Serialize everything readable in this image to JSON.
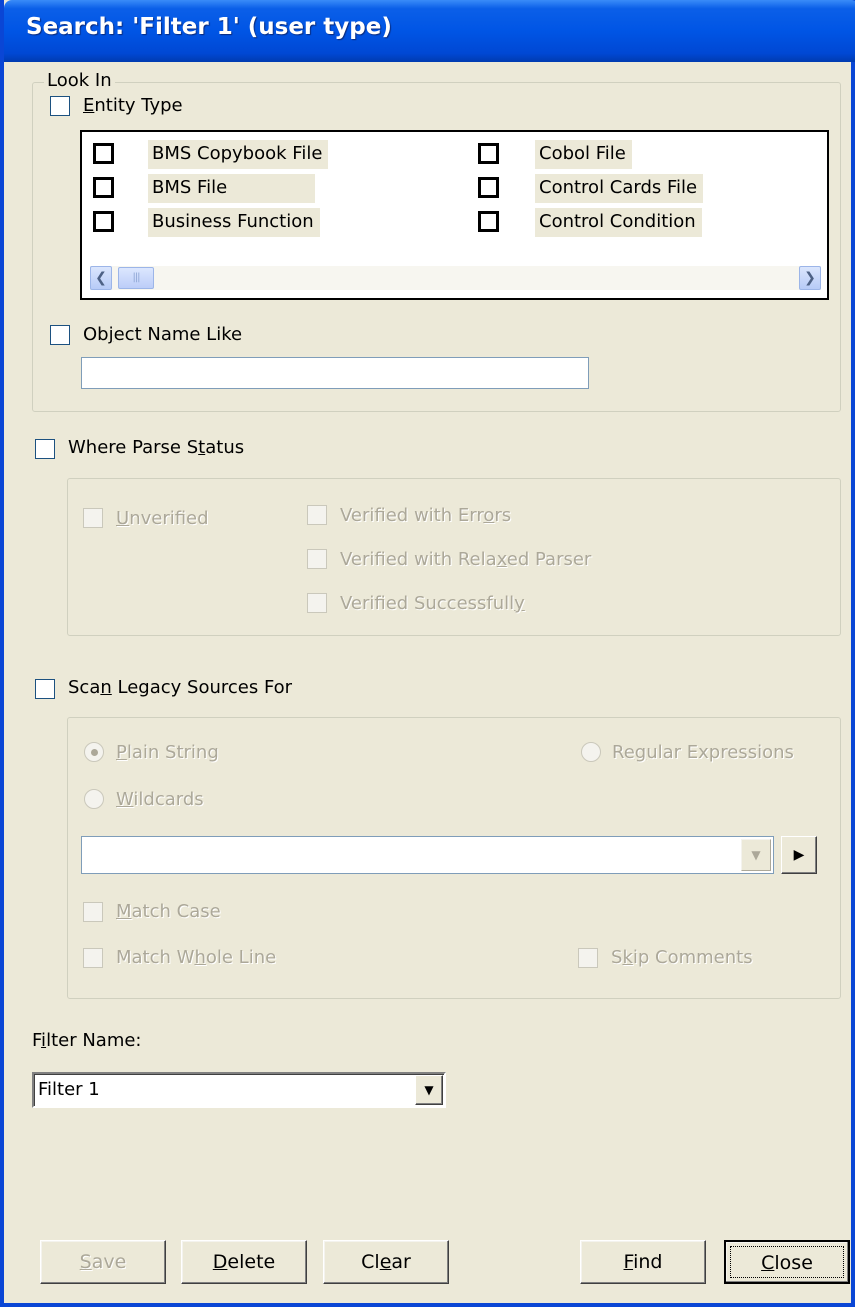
{
  "window": {
    "title": "Search: 'Filter 1' (user type)"
  },
  "look_in": {
    "legend": "Look In",
    "entity_type": {
      "label_pre": "",
      "label_ul": "E",
      "label_post": "ntity Type",
      "checked": false
    },
    "entities": [
      {
        "label": "BMS Copybook File",
        "checked": false
      },
      {
        "label": "BMS File",
        "checked": false
      },
      {
        "label": "Business Function",
        "checked": false
      },
      {
        "label": "Cobol File",
        "checked": false
      },
      {
        "label": "Control Cards File",
        "checked": false
      },
      {
        "label": "Control Condition",
        "checked": false
      }
    ],
    "object_name_like": {
      "label_pre": "Ob",
      "label_ul": "j",
      "label_post": "ect Name Like",
      "checked": false,
      "value": ""
    }
  },
  "parse_status": {
    "label_pre": "Where Parse S",
    "label_ul": "t",
    "label_post": "atus",
    "checked": false,
    "unverified": {
      "label_pre": "",
      "label_ul": "U",
      "label_post": "nverified"
    },
    "verified_errors": {
      "label_pre": "Verified with Err",
      "label_ul": "o",
      "label_post": "rs"
    },
    "verified_relaxed": {
      "label_pre": "Verified with Rela",
      "label_ul": "x",
      "label_post": "ed Parser"
    },
    "verified_success": {
      "label_pre": "Verified Successfull",
      "label_ul": "y",
      "label_post": ""
    }
  },
  "scan": {
    "label_pre": "Sca",
    "label_ul": "n",
    "label_post": " Legacy Sources For",
    "checked": false,
    "plain_string": {
      "label_pre": "",
      "label_ul": "P",
      "label_post": "lain String",
      "selected": true
    },
    "regular_expressions": {
      "label_pre": "Re",
      "label_ul": "g",
      "label_post": "ular Expressions",
      "selected": false
    },
    "wildcards": {
      "label_pre": "",
      "label_ul": "W",
      "label_post": "ildcards",
      "selected": false
    },
    "pattern_value": "",
    "match_case": {
      "label_pre": "",
      "label_ul": "M",
      "label_post": "atch Case"
    },
    "match_whole_line": {
      "label_pre": "Match W",
      "label_ul": "h",
      "label_post": "ole Line"
    },
    "skip_comments": {
      "label_pre": "S",
      "label_ul": "k",
      "label_post": "ip Comments"
    }
  },
  "filter": {
    "label_pre": "F",
    "label_ul": "i",
    "label_post": "lter Name:",
    "value": "Filter 1"
  },
  "buttons": {
    "save": {
      "ul": "S",
      "rest": "ave"
    },
    "delete": {
      "ul": "D",
      "rest": "elete"
    },
    "clear_pre": "Cl",
    "clear_ul": "e",
    "clear_post": "ar",
    "find": {
      "ul": "F",
      "rest": "ind"
    },
    "close": {
      "ul": "C",
      "rest": "lose"
    }
  }
}
